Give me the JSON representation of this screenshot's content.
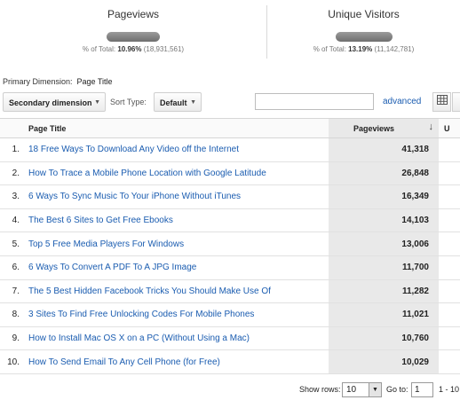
{
  "metrics": [
    {
      "label": "Pageviews",
      "pct_prefix": "% of Total: ",
      "pct": "10.96%",
      "total": " (18,931,561)"
    },
    {
      "label": "Unique Visitors",
      "pct_prefix": "% of Total: ",
      "pct": "13.19%",
      "total": " (11,142,781)"
    }
  ],
  "primary_dimension": {
    "label": "Primary Dimension:",
    "value": "Page Title"
  },
  "toolbar": {
    "secondary_dimension": "Secondary dimension",
    "sort_type_label": "Sort Type:",
    "sort_type_value": "Default",
    "advanced_link": "advanced"
  },
  "table": {
    "headers": {
      "title": "Page Title",
      "pageviews": "Pageviews",
      "unique": "U"
    },
    "rows": [
      {
        "n": "1.",
        "title": "18 Free Ways To Download Any Video off the Internet",
        "pageviews": "41,318"
      },
      {
        "n": "2.",
        "title": "How To Trace a Mobile Phone Location with Google Latitude",
        "pageviews": "26,848"
      },
      {
        "n": "3.",
        "title": "6 Ways To Sync Music To Your iPhone Without iTunes",
        "pageviews": "16,349"
      },
      {
        "n": "4.",
        "title": "The Best 6 Sites to Get Free Ebooks",
        "pageviews": "14,103"
      },
      {
        "n": "5.",
        "title": "Top 5 Free Media Players For Windows",
        "pageviews": "13,006"
      },
      {
        "n": "6.",
        "title": "6 Ways To Convert A PDF To A JPG Image",
        "pageviews": "11,700"
      },
      {
        "n": "7.",
        "title": "The 5 Best Hidden Facebook Tricks You Should Make Use Of",
        "pageviews": "11,282"
      },
      {
        "n": "8.",
        "title": "3 Sites To Find Free Unlocking Codes For Mobile Phones",
        "pageviews": "11,021"
      },
      {
        "n": "9.",
        "title": "How to Install Mac OS X on a PC (Without Using a Mac)",
        "pageviews": "10,760"
      },
      {
        "n": "10.",
        "title": "How To Send Email To Any Cell Phone (for Free)",
        "pageviews": "10,029"
      }
    ]
  },
  "footer": {
    "show_rows_label": "Show rows:",
    "show_rows_value": "10",
    "goto_label": "Go to:",
    "goto_value": "1",
    "range": "1 - 10"
  },
  "icons": {
    "sort_arrow": "arrow-down-icon",
    "view_table": "table-view-icon",
    "view_pie": "pie-view-icon"
  },
  "colors": {
    "link": "#1a5cb0",
    "highlight_column": "#e9e9e9"
  }
}
